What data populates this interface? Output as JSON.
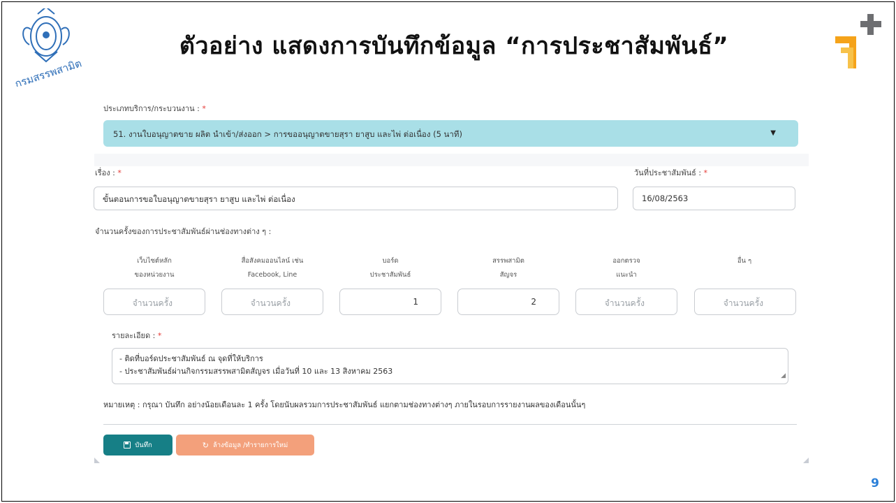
{
  "slide": {
    "title": "ตัวอย่าง แสดงการบันทึกข้อมูล “การประชาสัมพันธ์”",
    "page_number": "9",
    "logo_text": "กรมสรรพสามิต"
  },
  "form": {
    "service_type": {
      "label": "ประเภทบริการ/กระบวนงาน : ",
      "required": "*",
      "value": "51. งานใบอนุญาตขาย ผลิต นำเข้า/ส่งออก > การขออนุญาตขายสุรา ยาสูบ และไพ่ ต่อเนื่อง (5 นาที)"
    },
    "subject": {
      "label": "เรื่อง : ",
      "required": "*",
      "value": "ขั้นตอนการขอใบอนุญาตขายสุรา ยาสูบ และไพ่ ต่อเนื่อง"
    },
    "pr_date": {
      "label": "วันที่ประชาสัมพันธ์ : ",
      "required": "*",
      "value": "16/08/2563"
    },
    "channels_label": "จำนวนครั้งของการประชาสัมพันธ์ผ่านช่องทางต่าง ๆ :",
    "count_placeholder": "จำนวนครั้ง",
    "channels": [
      {
        "line1": "เว็บไซต์หลัก",
        "line2": "ของหน่วยงาน",
        "value": ""
      },
      {
        "line1": "สื่อสังคมออนไลน์ เช่น",
        "line2": "Facebook, Line",
        "value": ""
      },
      {
        "line1": "บอร์ด",
        "line2": "ประชาสัมพันธ์",
        "value": "1"
      },
      {
        "line1": "สรรพสามิต",
        "line2": "สัญจร",
        "value": "2"
      },
      {
        "line1": "ออกตรวจ",
        "line2": "แนะนำ",
        "value": ""
      },
      {
        "line1": "อื่น ๆ",
        "line2": "",
        "value": ""
      }
    ],
    "details": {
      "label": "รายละเอียด : ",
      "required": "*",
      "line1": "- ติดที่บอร์ดประชาสัมพันธ์ ณ จุดที่ให้บริการ",
      "line2": "- ประชาสัมพันธ์ผ่านกิจกรรมสรรพสามิตสัญจร เมื่อวันที่ 10 และ 13 สิงหาคม 2563"
    },
    "note": "หมายเหตุ : กรุณา บันทึก อย่างน้อยเดือนละ 1 ครั้ง โดยนับผลรวมการประชาสัมพันธ์ แยกตามช่องทางต่างๆ ภายในรอบการรายงานผลของเดือนนั้นๆ",
    "buttons": {
      "save": "บันทึก",
      "clear": "ล้างข้อมูล /ทำรายการใหม่"
    }
  },
  "colors": {
    "select_bg": "#a9dfe7",
    "save_button": "#167f86",
    "clear_button": "#f3a07b",
    "required_mark": "#e53935",
    "page_number": "#2a7fd8"
  }
}
